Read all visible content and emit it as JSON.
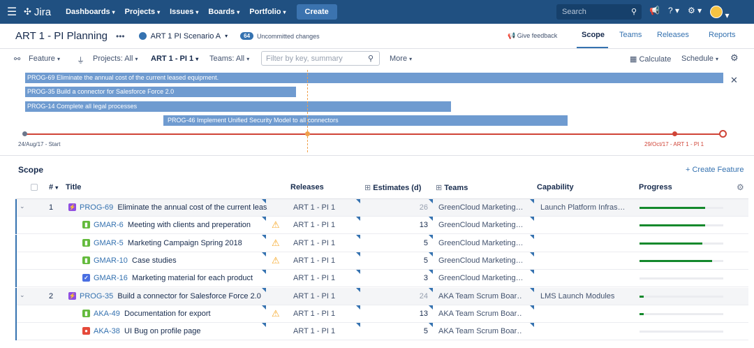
{
  "topnav": {
    "logo": "Jira",
    "items": [
      "Dashboards",
      "Projects",
      "Issues",
      "Boards",
      "Portfolio"
    ],
    "create": "Create",
    "search_placeholder": "Search"
  },
  "header": {
    "title": "ART 1 - PI Planning",
    "scenario": "ART 1 PI Scenario A",
    "uncommitted_count": "64",
    "uncommitted_label": "Uncommitted changes",
    "feedback": "Give feedback",
    "tabs": [
      "Scope",
      "Teams",
      "Releases",
      "Reports"
    ]
  },
  "toolbar": {
    "hierarchy": "Feature",
    "projects": "Projects: All",
    "release": "ART 1 - PI 1",
    "teams": "Teams: All",
    "filter_placeholder": "Filter by key, summary",
    "more": "More",
    "calculate": "Calculate",
    "schedule": "Schedule"
  },
  "timeline": {
    "bars": [
      {
        "label": "PROG-69 Eliminate the annual cost of the current leased equipment."
      },
      {
        "label": "PROG-35 Build a connector for Salesforce Force 2.0"
      },
      {
        "label": "PROG-14 Complete all legal processes"
      },
      {
        "label": "PROG-46 Implement Unified Security Model to all connectors"
      }
    ],
    "start_label": "24/Aug/17 - Start",
    "end_label": "29/Oct/17 - ART 1 - PI 1"
  },
  "scope": {
    "title": "Scope",
    "create_feature": "+ Create Feature",
    "columns": {
      "num": "#",
      "title": "Title",
      "releases": "Releases",
      "estimates": "Estimates (d)",
      "teams": "Teams",
      "capability": "Capability",
      "progress": "Progress"
    },
    "rows": [
      {
        "num": "1",
        "key": "PROG-69",
        "summary": "Eliminate the annual cost of the current leas…",
        "release": "ART 1 - PI 1",
        "estimate": "26",
        "team": "GreenCloud Marketing…",
        "capability": "Launch Platform Infras…",
        "progress": 0.78,
        "type": "epic",
        "parent": true,
        "warn": false
      },
      {
        "num": "",
        "key": "GMAR-6",
        "summary": "Meeting with clients and preperation",
        "release": "ART 1 - PI 1",
        "estimate": "13",
        "team": "GreenCloud Marketing…",
        "capability": "",
        "progress": 0.78,
        "type": "story",
        "parent": false,
        "warn": true
      },
      {
        "num": "",
        "key": "GMAR-5",
        "summary": "Marketing Campaign Spring 2018",
        "release": "ART 1 - PI 1",
        "estimate": "5",
        "team": "GreenCloud Marketing…",
        "capability": "",
        "progress": 0.75,
        "type": "story",
        "parent": false,
        "warn": true
      },
      {
        "num": "",
        "key": "GMAR-10",
        "summary": "Case studies",
        "release": "ART 1 - PI 1",
        "estimate": "5",
        "team": "GreenCloud Marketing…",
        "capability": "",
        "progress": 0.87,
        "type": "story",
        "parent": false,
        "warn": true
      },
      {
        "num": "",
        "key": "GMAR-16",
        "summary": "Marketing material for each product",
        "release": "ART 1 - PI 1",
        "estimate": "3",
        "team": "GreenCloud Marketing…",
        "capability": "",
        "progress": 0,
        "type": "task",
        "parent": false,
        "warn": false
      },
      {
        "num": "2",
        "key": "PROG-35",
        "summary": "Build a connector for Salesforce Force 2.0",
        "release": "ART 1 - PI 1",
        "estimate": "24",
        "team": "AKA Team Scrum Boar…",
        "capability": "LMS Launch Modules",
        "progress": 0.05,
        "type": "epic",
        "parent": true,
        "warn": false
      },
      {
        "num": "",
        "key": "AKA-49",
        "summary": "Documentation for export",
        "release": "ART 1 - PI 1",
        "estimate": "13",
        "team": "AKA Team Scrum Boar…",
        "capability": "",
        "progress": 0.05,
        "type": "story",
        "parent": false,
        "warn": true
      },
      {
        "num": "",
        "key": "AKA-38",
        "summary": "UI Bug on profile page",
        "release": "ART 1 - PI 1",
        "estimate": "5",
        "team": "AKA Team Scrum Boar…",
        "capability": "",
        "progress": 0,
        "type": "bug",
        "parent": false,
        "warn": false
      }
    ]
  }
}
